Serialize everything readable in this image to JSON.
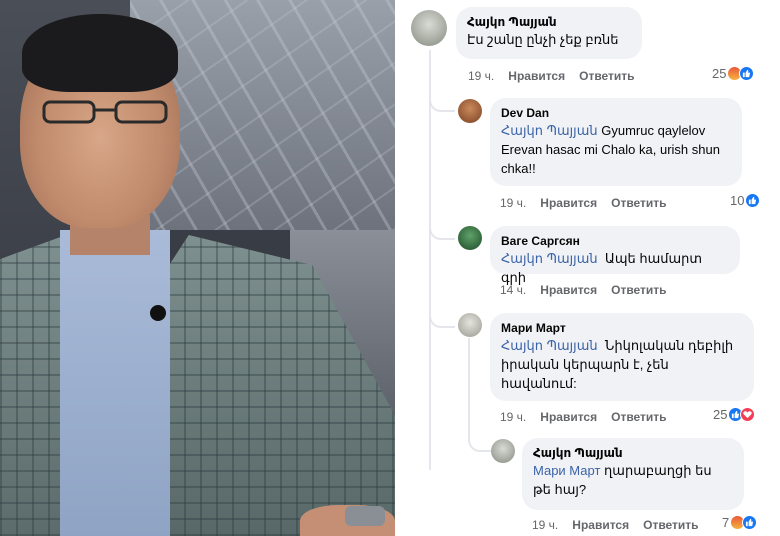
{
  "comments": [
    {
      "author": "Հայկո Պայյան",
      "mention": "",
      "text": "Էս շանը ընչի չեք բռնե",
      "time": "19 ч.",
      "like_label": "Нравится",
      "reply_label": "Ответить",
      "reaction_count": "25",
      "reactions": [
        "angry",
        "like"
      ]
    },
    {
      "author": "Dev Dan",
      "mention": "Հայկո Պայյան",
      "text": "Gyumruc qaylelov Erevan hasac mi Chalo ka, urish shun chka!!",
      "time": "19 ч.",
      "like_label": "Нравится",
      "reply_label": "Ответить",
      "reaction_count": "10",
      "reactions": [
        "like"
      ]
    },
    {
      "author": "Ваге Саргсян",
      "mention": "Հայկո Պայյան",
      "text": "Ապե համարտ գրի",
      "time": "14 ч.",
      "like_label": "Нравится",
      "reply_label": "Ответить",
      "reaction_count": "",
      "reactions": []
    },
    {
      "author": "Мари Март",
      "mention": "Հայկո Պայյան",
      "text": "Նիկոլական դեբիլի իրական կերպարն է, չեն հավանում:",
      "time": "19 ч.",
      "like_label": "Нравится",
      "reply_label": "Ответить",
      "reaction_count": "25",
      "reactions": [
        "like",
        "love"
      ]
    },
    {
      "author": "Հայկո Պայյան",
      "mention": "Мари Март",
      "text": "ղարաբաղցի ես թե հայ?",
      "time": "19 ч.",
      "like_label": "Нравится",
      "reply_label": "Ответить",
      "reaction_count": "7",
      "reactions": [
        "angry",
        "like"
      ]
    }
  ],
  "colors": {
    "bubble": "#f0f2f5",
    "mention": "#3b63a8",
    "meta": "#65676b",
    "like": "#1877f2",
    "love": "#f33e58"
  }
}
